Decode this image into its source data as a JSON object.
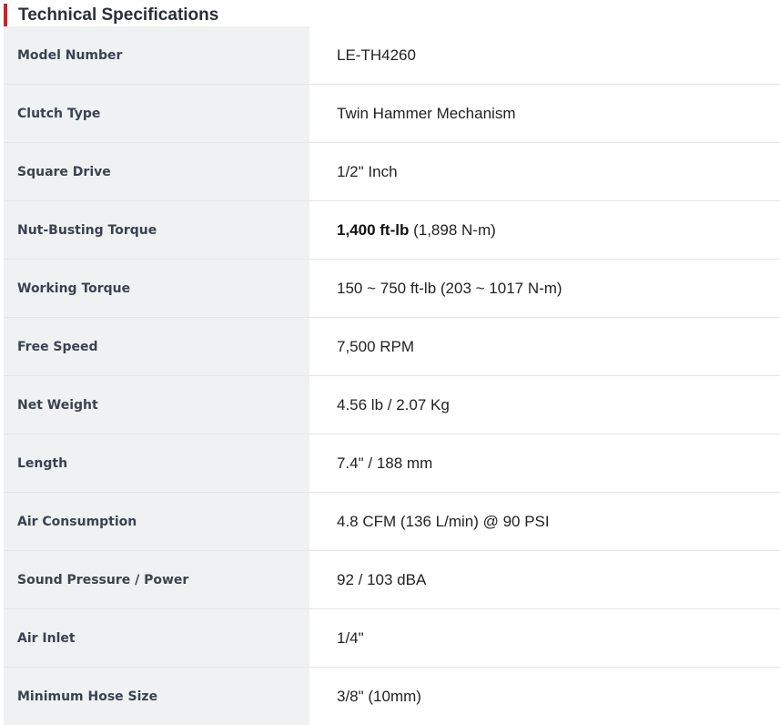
{
  "section": {
    "title": "Technical Specifications",
    "accent_color": "#cc2229"
  },
  "specs": [
    {
      "label": "Model Number",
      "value": "LE-TH4260"
    },
    {
      "label": "Clutch Type",
      "value": "Twin Hammer Mechanism"
    },
    {
      "label": "Square Drive",
      "value": "1/2\" Inch"
    },
    {
      "label": "Nut-Busting Torque",
      "value_strong": "1,400 ft-lb",
      "value_rest": " (1,898 N-m)"
    },
    {
      "label": "Working Torque",
      "value": "150 ~ 750 ft-lb (203 ~ 1017 N-m)"
    },
    {
      "label": "Free Speed",
      "value": "7,500 RPM"
    },
    {
      "label": "Net Weight",
      "value": "4.56 lb / 2.07 Kg"
    },
    {
      "label": "Length",
      "value": "7.4\" / 188 mm"
    },
    {
      "label": "Air Consumption",
      "value": "4.8 CFM (136 L/min) @ 90 PSI"
    },
    {
      "label": "Sound Pressure / Power",
      "value": "92 / 103 dBA"
    },
    {
      "label": "Air Inlet",
      "value": "1/4\""
    },
    {
      "label": "Minimum Hose Size",
      "value": "3/8\" (10mm)"
    }
  ]
}
